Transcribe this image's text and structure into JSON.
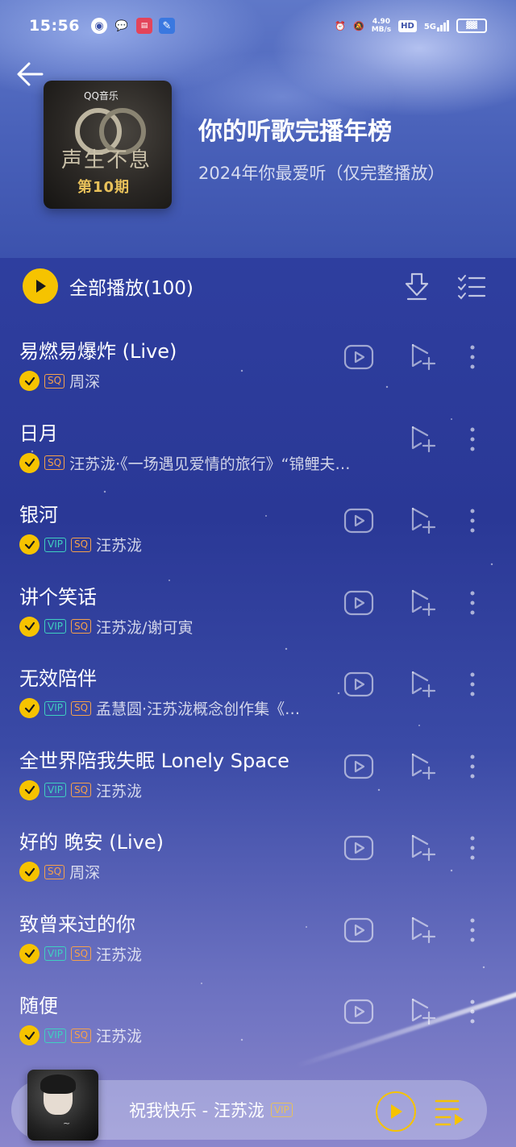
{
  "status_bar": {
    "time": "15:56",
    "network_speed_value": "4.90",
    "network_speed_unit": "MB/s",
    "hd_label": "HD",
    "signal_label": "5G"
  },
  "header": {
    "playlist_title": "你的听歌完播年榜",
    "playlist_subtitle": "2024年你最爱听（仅完整播放）",
    "cover": {
      "logo_text": "QQ音乐",
      "title_text": "声生不息",
      "issue_text": "第10期"
    }
  },
  "play_all": {
    "label": "全部播放(100)"
  },
  "songs": [
    {
      "title": "易燃易爆炸 (Live)",
      "vip": false,
      "sq": true,
      "artist": "周深",
      "has_mv": true
    },
    {
      "title": "日月",
      "vip": false,
      "sq": true,
      "artist": "汪苏泷·《一场遇见爱情的旅行》“锦鲤夫…",
      "has_mv": false
    },
    {
      "title": "银河",
      "vip": true,
      "sq": true,
      "artist": "汪苏泷",
      "has_mv": true
    },
    {
      "title": "讲个笑话",
      "vip": true,
      "sq": true,
      "artist": "汪苏泷/谢可寅",
      "has_mv": true
    },
    {
      "title": "无效陪伴",
      "vip": true,
      "sq": true,
      "artist": "孟慧圆·汪苏泷概念创作集《…",
      "has_mv": true
    },
    {
      "title": "全世界陪我失眠 Lonely Space",
      "vip": true,
      "sq": true,
      "artist": "汪苏泷",
      "has_mv": true
    },
    {
      "title": "好的 晚安 (Live)",
      "vip": false,
      "sq": true,
      "artist": "周深",
      "has_mv": true
    },
    {
      "title": "致曾来过的你",
      "vip": true,
      "sq": true,
      "artist": "汪苏泷",
      "has_mv": true
    },
    {
      "title": "随便",
      "vip": true,
      "sq": true,
      "artist": "汪苏泷",
      "has_mv": true
    }
  ],
  "tags": {
    "vip": "VIP",
    "sq": "SQ"
  },
  "player": {
    "track_text": "祝我快乐 - 汪苏泷",
    "vip_label": "VIP"
  },
  "colors": {
    "accent_yellow": "#f6c300",
    "vip_teal": "#3fd0c0",
    "sq_orange": "#f5a14c",
    "background_blue": "#2f3fa0"
  },
  "icons": [
    "back-arrow-icon",
    "download-icon",
    "multiselect-icon",
    "mv-icon",
    "add-to-playlist-icon",
    "more-icon",
    "play-icon",
    "queue-icon",
    "check-icon"
  ]
}
